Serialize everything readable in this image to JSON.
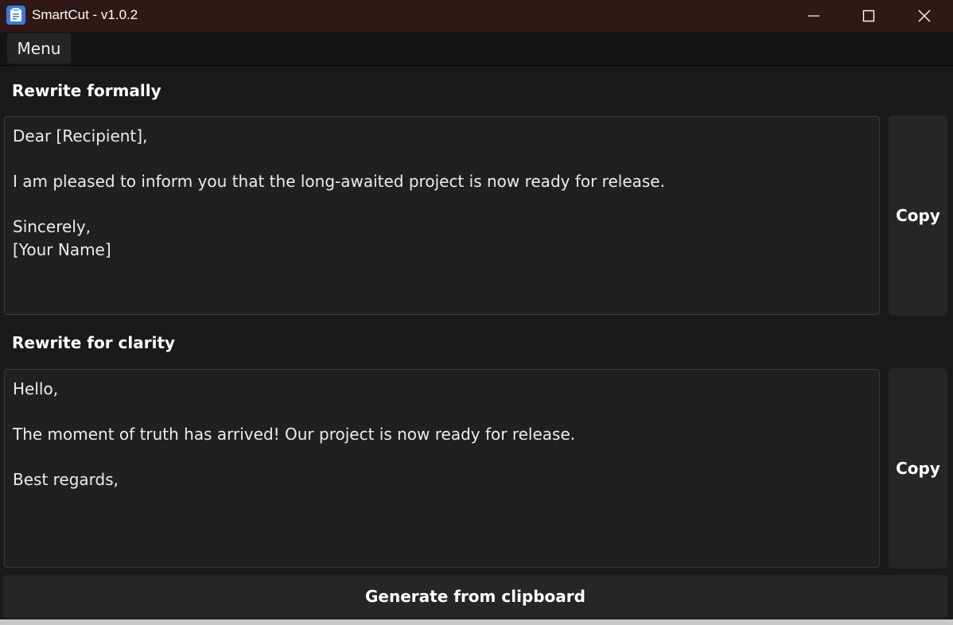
{
  "window": {
    "title": "SmartCut - v1.0.2",
    "accent": "#301818"
  },
  "menubar": {
    "menu_label": "Menu"
  },
  "sections": [
    {
      "label": "Rewrite formally",
      "text": "Dear [Recipient],\n\nI am pleased to inform you that the long-awaited project is now ready for release.\n\nSincerely,\n[Your Name]",
      "copy_label": "Copy"
    },
    {
      "label": "Rewrite for clarity",
      "text": "Hello,\n\nThe moment of truth has arrived! Our project is now ready for release.\n\nBest regards,",
      "copy_label": "Copy"
    }
  ],
  "footer": {
    "generate_label": "Generate from clipboard"
  },
  "icons": {
    "app": "clipboard-icon",
    "minimize": "minimize-icon",
    "maximize": "maximize-icon",
    "close": "close-icon"
  }
}
